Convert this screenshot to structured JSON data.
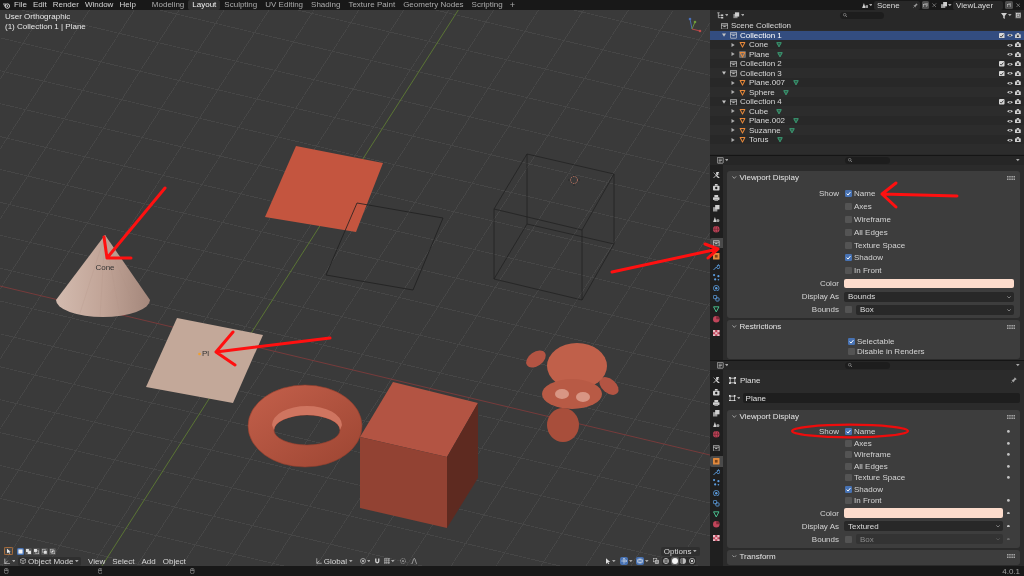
{
  "top_bar": {
    "menus": [
      "File",
      "Edit",
      "Render",
      "Window",
      "Help"
    ],
    "workspaces": [
      {
        "label": "Modeling",
        "selected": false
      },
      {
        "label": "Layout",
        "selected": true
      },
      {
        "label": "Sculpting",
        "selected": false
      },
      {
        "label": "UV Editing",
        "selected": false
      },
      {
        "label": "Shading",
        "selected": false
      },
      {
        "label": "Texture Paint",
        "selected": false
      },
      {
        "label": "Geometry Nodes",
        "selected": false
      },
      {
        "label": "Scripting",
        "selected": false
      }
    ],
    "add_workspace": "+",
    "scene": "Scene",
    "view_layer": "ViewLayer"
  },
  "viewport": {
    "view_name": "User Orthographic",
    "context": "(1) Collection 1 | Plane",
    "object_labels": [
      "Cone",
      "Pl"
    ],
    "select_modes": [
      {
        "selected": true
      },
      {
        "selected": false
      },
      {
        "selected": false
      },
      {
        "selected": false
      },
      {
        "selected": false
      }
    ],
    "options": "Options",
    "mode": "Object Mode",
    "menus": [
      "View",
      "Select",
      "Add",
      "Object"
    ],
    "orientation": "Global",
    "show_gizmos": true,
    "show_overlays": true,
    "shading_modes": [
      {
        "selected": false
      },
      {
        "selected": true
      },
      {
        "selected": false
      },
      {
        "selected": false
      }
    ]
  },
  "outliner": {
    "root": "Scene Collection",
    "items": [
      {
        "kind": "collection",
        "label": "Collection 1",
        "selected": true,
        "expanded": true,
        "checked": true,
        "children": [
          {
            "kind": "object",
            "label": "Cone",
            "selected": false,
            "active": false,
            "expanded": false
          },
          {
            "kind": "object",
            "label": "Plane",
            "selected": false,
            "active": true,
            "expanded": false
          }
        ]
      },
      {
        "kind": "collection",
        "label": "Collection 2",
        "selected": false,
        "checked": true
      },
      {
        "kind": "collection",
        "label": "Collection 3",
        "selected": false,
        "expanded": true,
        "checked": true,
        "children": [
          {
            "kind": "object",
            "label": "Plane.007",
            "selected": false,
            "active": false,
            "expanded": false
          },
          {
            "kind": "object",
            "label": "Sphere",
            "selected": false,
            "active": false,
            "expanded": false
          }
        ]
      },
      {
        "kind": "collection",
        "label": "Collection 4",
        "selected": false,
        "expanded": true,
        "checked": true,
        "children": [
          {
            "kind": "object",
            "label": "Cube",
            "selected": false,
            "active": false,
            "expanded": false
          },
          {
            "kind": "object",
            "label": "Plane.002",
            "selected": false,
            "active": false,
            "expanded": false
          },
          {
            "kind": "object",
            "label": "Suzanne",
            "selected": false,
            "active": false,
            "expanded": false
          },
          {
            "kind": "object",
            "label": "Torus",
            "selected": false,
            "active": false,
            "expanded": false
          }
        ]
      }
    ]
  },
  "properties": [
    {
      "tabs": [
        {
          "kind": "tool",
          "selected": false
        },
        {
          "kind": "render",
          "selected": false
        },
        {
          "kind": "output",
          "selected": false
        },
        {
          "kind": "view_layer",
          "selected": false
        },
        {
          "kind": "scene",
          "selected": false
        },
        {
          "kind": "world",
          "selected": false
        },
        {
          "kind": "collection",
          "selected": true
        },
        {
          "kind": "object",
          "selected": false
        },
        {
          "kind": "modifiers",
          "selected": false
        },
        {
          "kind": "particles",
          "selected": false
        },
        {
          "kind": "physics",
          "selected": false
        },
        {
          "kind": "constraints",
          "selected": false
        },
        {
          "kind": "data",
          "selected": false
        },
        {
          "kind": "material",
          "selected": false
        },
        {
          "kind": "texture",
          "selected": false
        }
      ],
      "sections": [
        {
          "title": "Viewport Display",
          "expanded": true,
          "rows": [
            {
              "kind": "checkbox",
              "label": "Show",
              "text": "Name",
              "checked": true
            },
            {
              "kind": "checkbox",
              "text": "Axes",
              "checked": false
            },
            {
              "kind": "checkbox",
              "text": "Wireframe",
              "checked": false
            },
            {
              "kind": "checkbox",
              "text": "All Edges",
              "checked": false
            },
            {
              "kind": "checkbox",
              "text": "Texture Space",
              "checked": false
            },
            {
              "kind": "checkbox",
              "text": "Shadow",
              "checked": true
            },
            {
              "kind": "checkbox",
              "text": "In Front",
              "checked": false
            },
            {
              "kind": "color",
              "label": "Color",
              "color": "#fddccc"
            },
            {
              "kind": "dropdown",
              "label": "Display As",
              "value": "Bounds"
            },
            {
              "kind": "toggle_dropdown",
              "label": "Bounds",
              "checked": false,
              "value": "Box",
              "disabled": false
            }
          ]
        },
        {
          "title": "Restrictions",
          "expanded": true,
          "rows": [
            {
              "kind": "checkbox",
              "text": "Selectable",
              "checked": true
            },
            {
              "kind": "checkbox",
              "text": "Disable in Renders",
              "checked": false
            }
          ]
        }
      ]
    },
    {
      "tabs": [
        {
          "kind": "tool",
          "selected": false
        },
        {
          "kind": "render",
          "selected": false
        },
        {
          "kind": "output",
          "selected": false
        },
        {
          "kind": "view_layer",
          "selected": false
        },
        {
          "kind": "scene",
          "selected": false
        },
        {
          "kind": "world",
          "selected": false
        },
        {
          "kind": "collection",
          "selected": false
        },
        {
          "kind": "object",
          "selected": true
        },
        {
          "kind": "modifiers",
          "selected": false
        },
        {
          "kind": "particles",
          "selected": false
        },
        {
          "kind": "physics",
          "selected": false
        },
        {
          "kind": "constraints",
          "selected": false
        },
        {
          "kind": "data",
          "selected": false
        },
        {
          "kind": "material",
          "selected": false
        },
        {
          "kind": "texture",
          "selected": false
        }
      ],
      "object_name": "Plane",
      "name_field": "Plane",
      "sections": [
        {
          "title": "Viewport Display",
          "expanded": true,
          "rows": [
            {
              "kind": "checkbox",
              "label": "Show",
              "text": "Name",
              "checked": true,
              "animatable": true
            },
            {
              "kind": "checkbox",
              "text": "Axes",
              "checked": false,
              "animatable": true
            },
            {
              "kind": "checkbox",
              "text": "Wireframe",
              "checked": false,
              "animatable": true
            },
            {
              "kind": "checkbox",
              "text": "All Edges",
              "checked": false,
              "animatable": true
            },
            {
              "kind": "checkbox",
              "text": "Texture Space",
              "checked": false,
              "animatable": true
            },
            {
              "kind": "checkbox",
              "text": "Shadow",
              "checked": true,
              "animatable": false
            },
            {
              "kind": "checkbox",
              "text": "In Front",
              "checked": false,
              "animatable": true
            },
            {
              "kind": "color",
              "label": "Color",
              "color": "#fddccc",
              "animatable": true
            },
            {
              "kind": "dropdown",
              "label": "Display As",
              "value": "Textured",
              "animatable": true
            },
            {
              "kind": "toggle_dropdown",
              "label": "Bounds",
              "checked": false,
              "value": "Box",
              "disabled": true,
              "animatable": true
            }
          ]
        },
        {
          "title": "Transform",
          "expanded": true
        }
      ]
    }
  ],
  "status_bar": {
    "version": "4.0.1"
  }
}
